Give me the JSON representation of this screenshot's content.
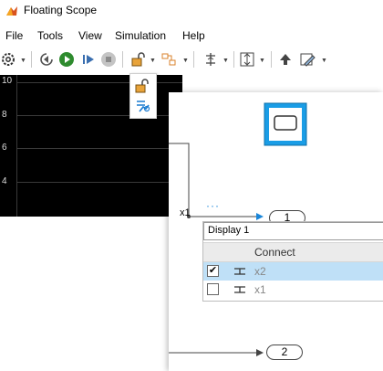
{
  "window": {
    "title": "Floating Scope"
  },
  "menu": [
    "File",
    "Tools",
    "View",
    "Simulation",
    "Help"
  ],
  "toolbar": {
    "icons": [
      "settings-icon",
      "step-back-icon",
      "run-icon",
      "step-forward-icon",
      "stop-icon",
      "lock-icon",
      "signal-selector-icon",
      "cursor-measure-icon",
      "zoom-fit-icon",
      "highlight-icon",
      "style-icon"
    ]
  },
  "plot": {
    "yticks": [
      "10",
      "8",
      "6",
      "4"
    ]
  },
  "canvas": {
    "signal_label": "x1",
    "ellipsis": "···",
    "port_out_1": "1",
    "port_out_2": "2"
  },
  "connect_panel": {
    "input_value": "Display 1",
    "header": "Connect",
    "rows": [
      {
        "name": "x2",
        "checked": "✔"
      },
      {
        "name": "x1",
        "checked": ""
      }
    ]
  }
}
